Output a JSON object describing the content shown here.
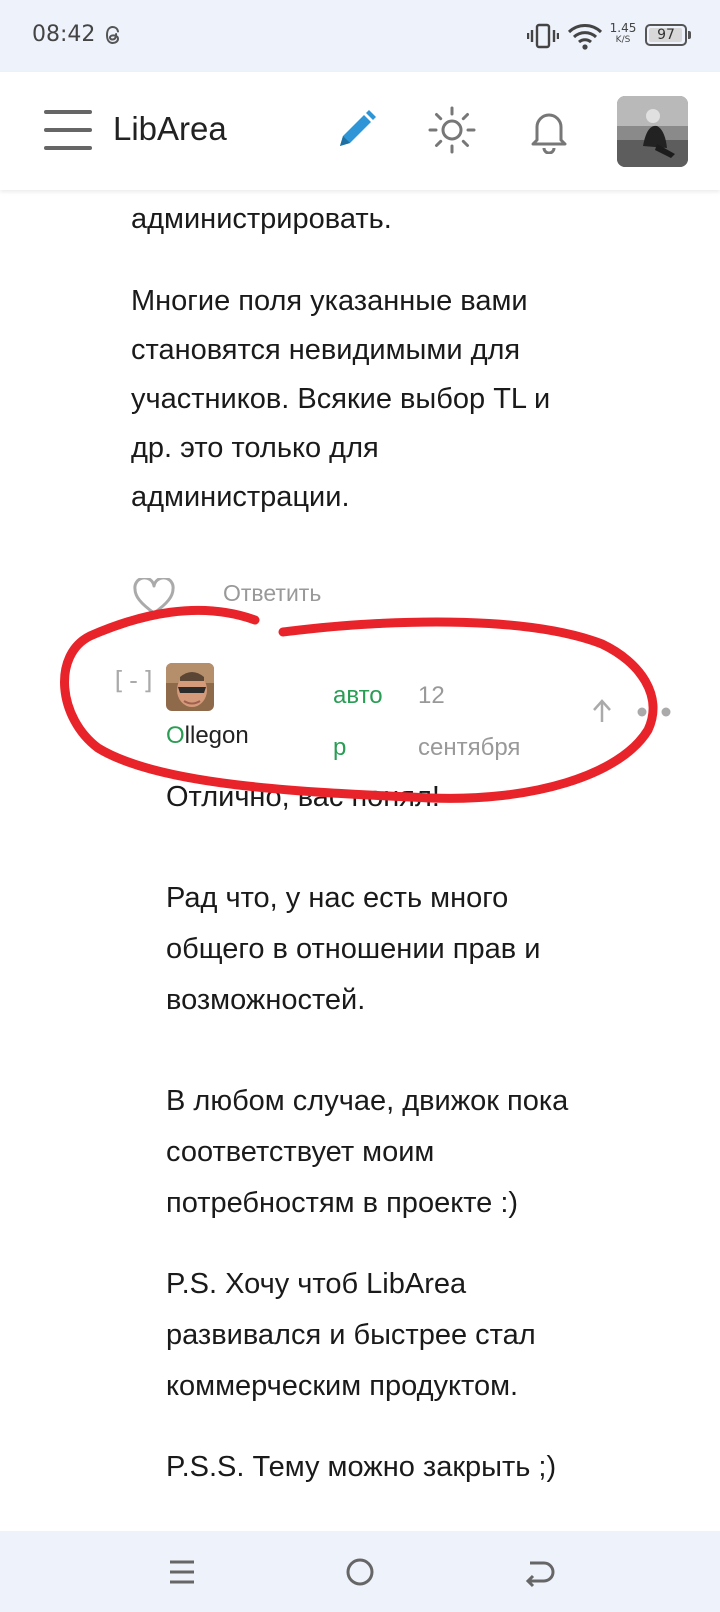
{
  "status_bar": {
    "time": "08:42",
    "net_speed": "1.45",
    "net_unit": "K/S",
    "battery": "97",
    "battery_level": 0.97
  },
  "header": {
    "site_title": "LibArea",
    "icons": [
      "menu-icon",
      "pencil-icon",
      "sun-icon",
      "bell-icon",
      "avatar"
    ],
    "accent_color": "#2e96d6"
  },
  "post": {
    "lines": [
      "администрировать.",
      "Многие поля указанные вами",
      "становятся невидимыми для",
      "участников. Всякие выбор TL и",
      "др. это только для",
      "администрации."
    ],
    "like_icon": "heart-icon",
    "reply_label": "Ответить"
  },
  "comment": {
    "collapse_label": "[-]",
    "author_first": "O",
    "author_rest": "llegon",
    "badge_line1": "авто",
    "badge_line2": "р",
    "date_line1": "12",
    "date_line2": "сентября",
    "badge_color": "#2a9d55",
    "annotation_color": "#e8242a",
    "text": {
      "p1": "Отлично, вас понял!",
      "p2": [
        "Рад что, у нас есть много",
        "общего в отношении прав и",
        "возможностей."
      ],
      "p3": [
        "В любом случае, движок пока",
        "соответствует моим",
        "потребностям в проекте :)"
      ],
      "p4": [
        "P.S. Хочу чтоб LibArea",
        "развивался и быстрее стал",
        "коммерческим продуктом."
      ],
      "p5": "P.S.S. Тему можно закрыть ;)"
    }
  },
  "nav_bar": {
    "buttons": [
      "menu-nav-icon",
      "home-circle-icon",
      "back-icon"
    ]
  }
}
